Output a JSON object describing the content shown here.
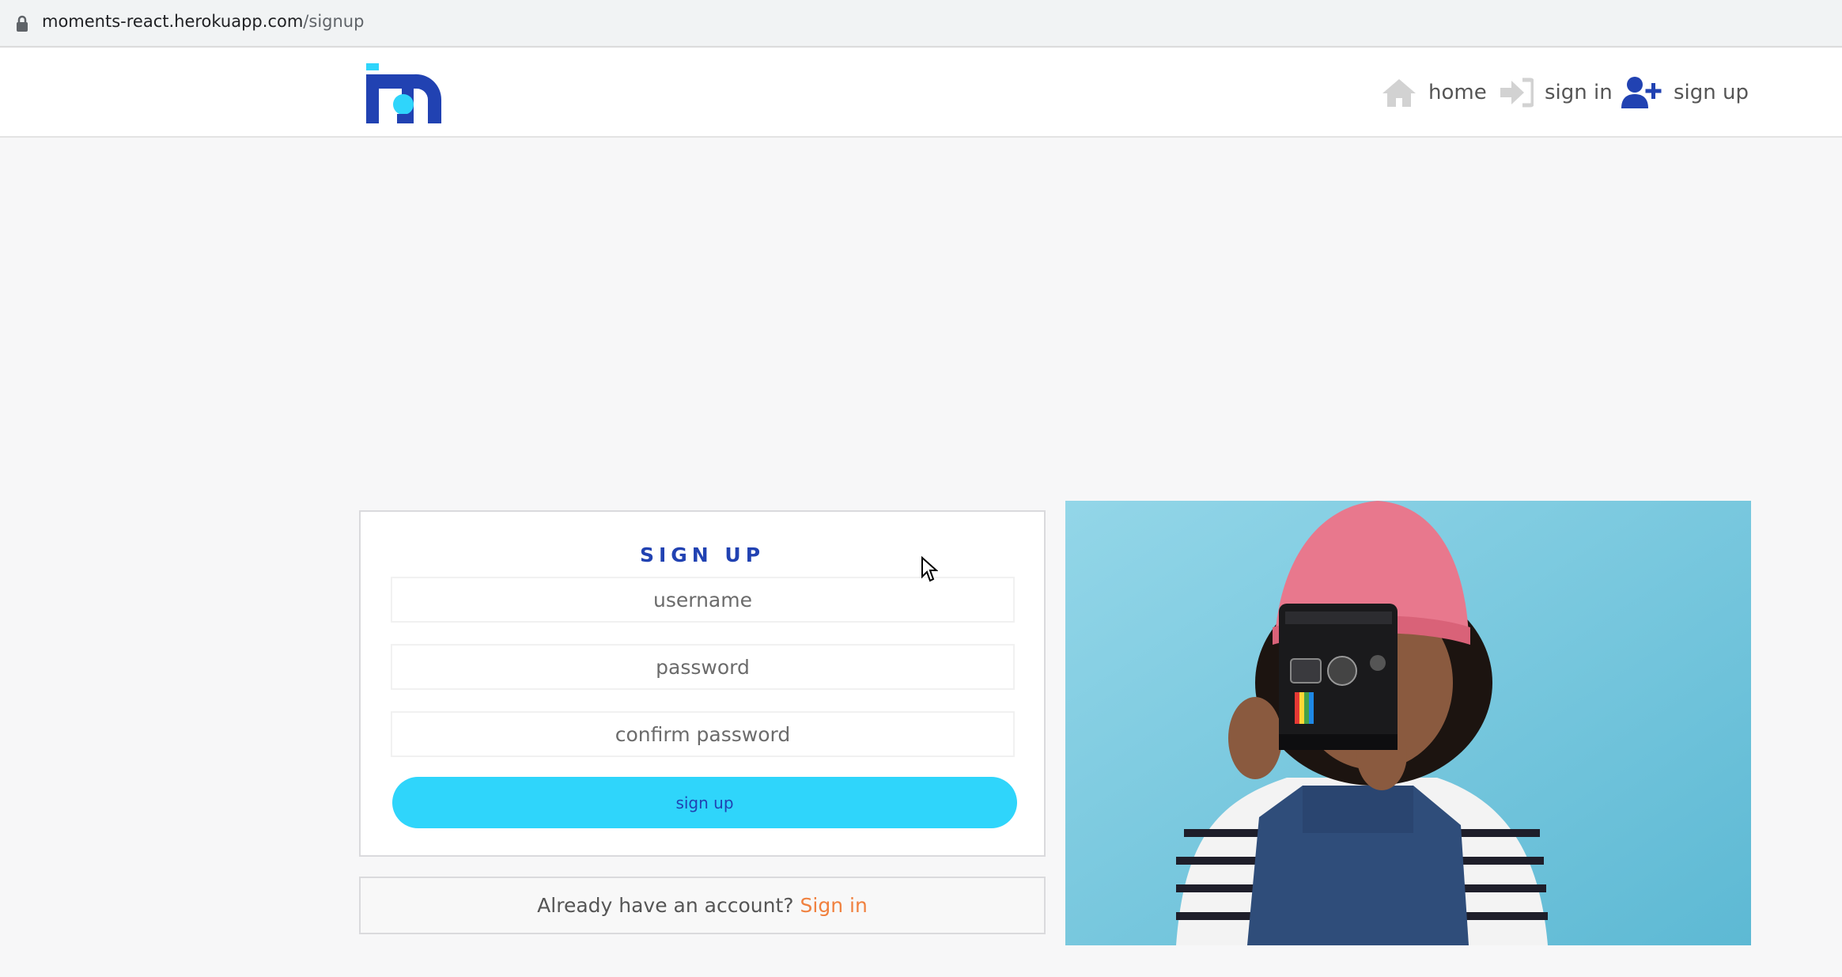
{
  "browser": {
    "url_host": "moments-react.herokuapp.com",
    "url_path": "/signup"
  },
  "navbar": {
    "items": [
      {
        "label": "home",
        "icon": "house-icon"
      },
      {
        "label": "sign in",
        "icon": "sign-in-arrow-icon"
      },
      {
        "label": "sign up",
        "icon": "user-plus-icon"
      }
    ]
  },
  "signup": {
    "title": "SIGN UP",
    "username_placeholder": "username",
    "password_placeholder": "password",
    "confirm_placeholder": "confirm password",
    "button_label": "sign up"
  },
  "signin_prompt": {
    "text": "Already have an account?",
    "link": "Sign in"
  },
  "colors": {
    "brand_blue": "#2142b2",
    "accent_cyan": "#2fd5fb",
    "link_orange": "#f0813f"
  }
}
